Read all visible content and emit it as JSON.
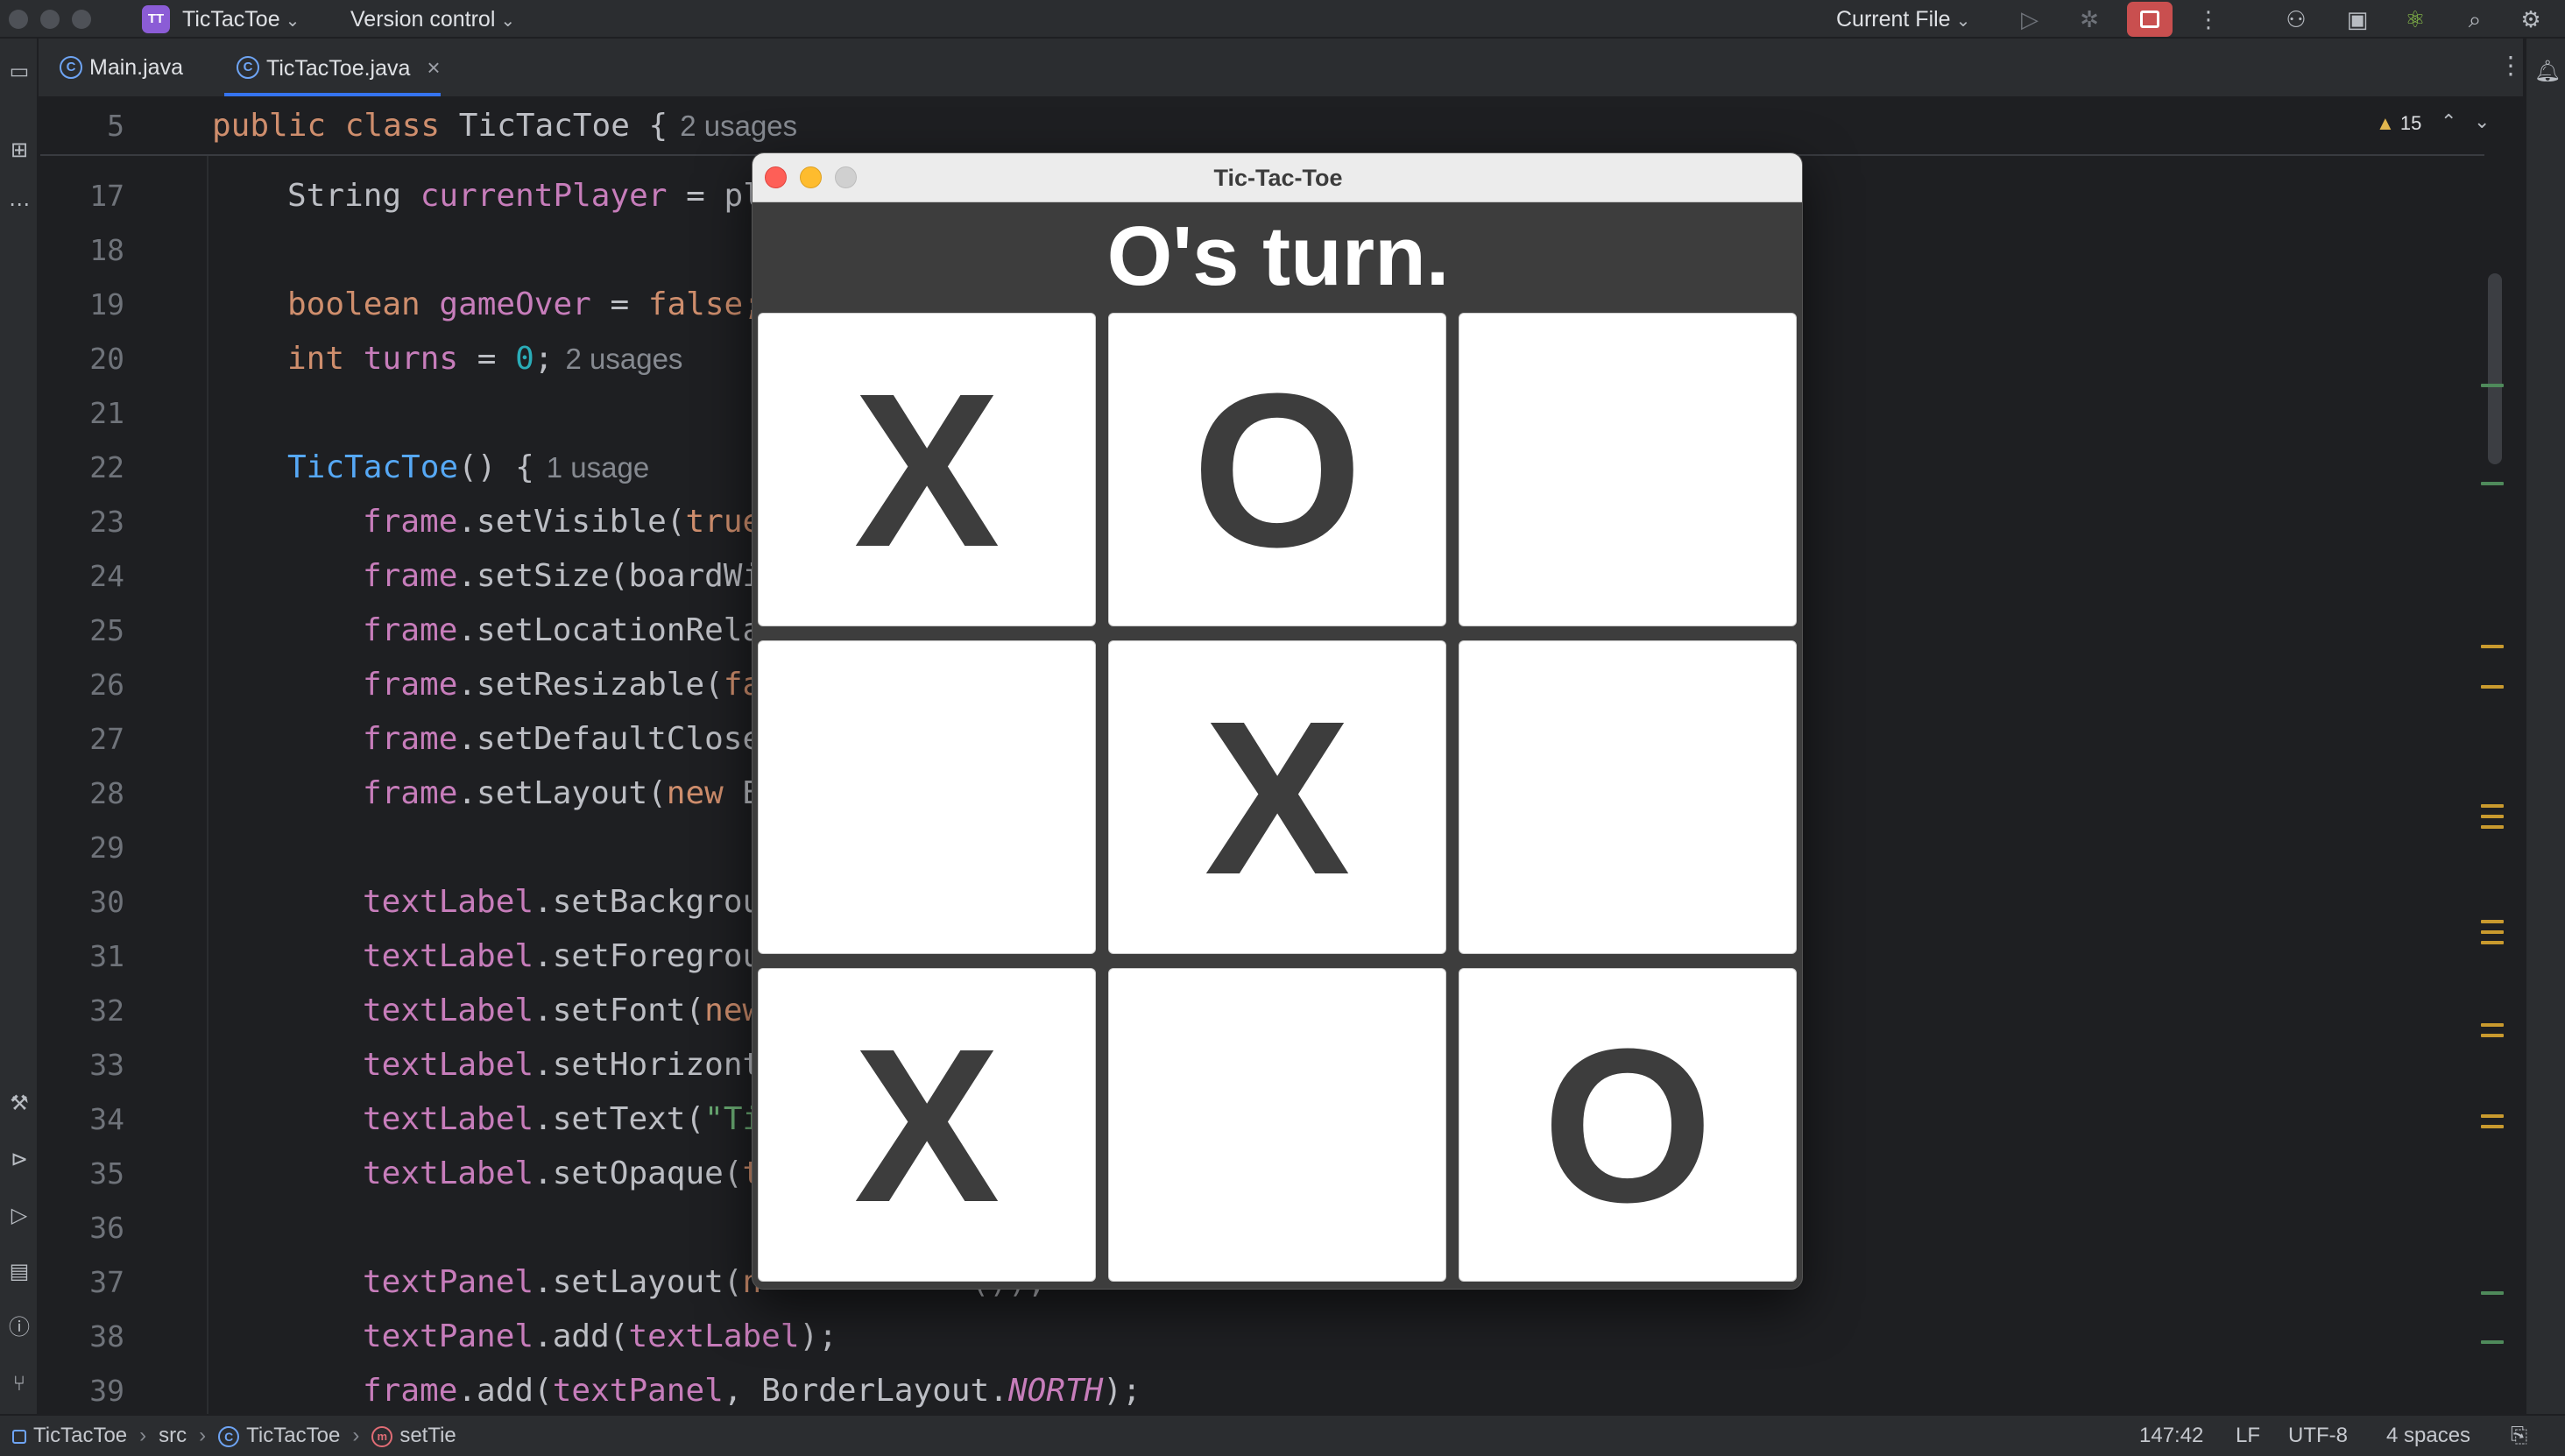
{
  "titlebar": {
    "project_badge": "TT",
    "project_name": "TicTacToe",
    "version_control": "Version control",
    "run_config": "Current File"
  },
  "tabs": [
    {
      "label": "Main.java"
    },
    {
      "label": "TicTacToe.java"
    }
  ],
  "editor": {
    "warnings_count": "15",
    "lines": [
      {
        "n": "5"
      },
      {
        "n": "17"
      },
      {
        "n": "18"
      },
      {
        "n": "19"
      },
      {
        "n": "20"
      },
      {
        "n": "21"
      },
      {
        "n": "22"
      },
      {
        "n": "23"
      },
      {
        "n": "24"
      },
      {
        "n": "25"
      },
      {
        "n": "26"
      },
      {
        "n": "27"
      },
      {
        "n": "28"
      },
      {
        "n": "29"
      },
      {
        "n": "30"
      },
      {
        "n": "31"
      },
      {
        "n": "32"
      },
      {
        "n": "33"
      },
      {
        "n": "34"
      },
      {
        "n": "35"
      },
      {
        "n": "36"
      },
      {
        "n": "37"
      },
      {
        "n": "38"
      },
      {
        "n": "39"
      }
    ],
    "code": {
      "l5_kw1": "public",
      "l5_kw2": "class",
      "l5_name": "TicTacToe {",
      "l5_hint": "2 usages",
      "l17_type": "String",
      "l17_field": "currentPlayer",
      "l17_rest": " = pl",
      "l19_type": "boolean",
      "l19_field": "gameOver",
      "l19_eq": " = ",
      "l19_val": "false;",
      "l20_type": "int",
      "l20_field": "turns",
      "l20_eq": " = ",
      "l20_val": "0",
      "l20_semi": ";",
      "l20_hint": "2 usages",
      "l22_fn": "TicTacToe",
      "l22_rest": "() {",
      "l22_hint": "1 usage",
      "l23_obj": "frame",
      "l23_rest": ".setVisible(",
      "l23_kw": "true",
      "l24_obj": "frame",
      "l24_rest": ".setSize(boardWi",
      "l25_obj": "frame",
      "l25_rest": ".setLocationRela",
      "l26_obj": "frame",
      "l26_rest": ".setResizable(",
      "l26_kw": "fa",
      "l27_obj": "frame",
      "l27_rest": ".setDefaultClose",
      "l28_obj": "frame",
      "l28_rest": ".setLayout(",
      "l28_kw": "new",
      "l28_tail": " B",
      "l30_obj": "textLabel",
      "l30_rest": ".setBackgrou",
      "l31_obj": "textLabel",
      "l31_rest": ".setForegrou",
      "l32_obj": "textLabel",
      "l32_rest": ".setFont(",
      "l32_kw": "new",
      "l33_obj": "textLabel",
      "l33_rest": ".setHorizont",
      "l34_obj": "textLabel",
      "l34_rest": ".setText(",
      "l34_str": "\"Ti",
      "l35_obj": "textLabel",
      "l35_rest": ".setOpaque(",
      "l35_kw": "t",
      "l37_obj": "textPanel",
      "l37_rest": ".setLayout(",
      "l37_kw": "n",
      "l37_tail": "           ());",
      "l38_obj": "textPanel",
      "l38_rest": ".add(",
      "l38_arg": "textLabel",
      "l38_end": ");",
      "l39_obj": "frame",
      "l39_rest": ".add(",
      "l39_arg": "textPanel",
      "l39_mid": ", BorderLayout.",
      "l39_const": "NORTH",
      "l39_end": ");"
    }
  },
  "game": {
    "window_title": "Tic-Tac-Toe",
    "status": "O's turn.",
    "board": [
      "X",
      "O",
      "",
      "",
      "X",
      "",
      "X",
      "",
      "O"
    ]
  },
  "statusbar": {
    "crumb_project": "TicTacToe",
    "crumb_src": "src",
    "crumb_class": "TicTacToe",
    "crumb_method": "setTie",
    "position": "147:42",
    "line_sep": "LF",
    "encoding": "UTF-8",
    "indent": "4 spaces"
  },
  "colors": {
    "accent": "#3574f0",
    "stop_button": "#c94f4f",
    "keyword": "#cf8e6d",
    "field": "#c77dbb",
    "function": "#56a8f5",
    "number": "#2aacb8",
    "warning": "#e0b64e"
  }
}
